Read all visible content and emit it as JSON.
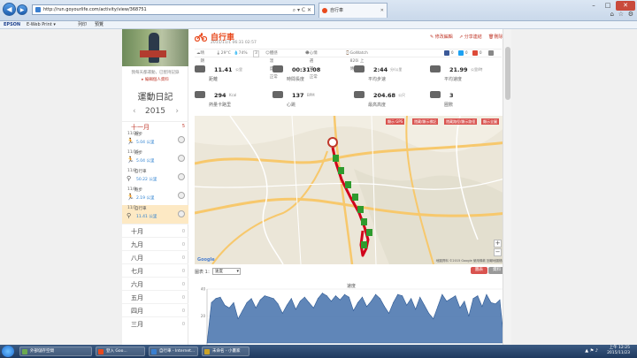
{
  "browser": {
    "address": "http://run.goyourlife.com/activity/view/368751",
    "tab_title": "自行車",
    "window_min": "–",
    "window_max": "□",
    "window_close": "✕",
    "nav_back": "◀",
    "nav_forward": "▶",
    "addr_controls": "⌕ ▾ C ✕",
    "tab_close": "✕",
    "tools_home": "⌂",
    "tools_star": "☆",
    "tools_gear": "⚙"
  },
  "favbar": {
    "epson": "EPSON",
    "eweb": "E-Web Print ▾",
    "print": "列印",
    "preview": "預覽"
  },
  "profile": {
    "text": "我每天都運動，已堅持記錄",
    "link": "▸ 編輯個人資料"
  },
  "diary": {
    "title": "運動日記",
    "year": "2015",
    "prev": "‹",
    "next": "›",
    "current_month": "十一月",
    "current_month_count": "5",
    "activities": [
      {
        "date": "11/22",
        "name": "跑步",
        "distance": "5.04 公里",
        "icon": "run-icon",
        "selected": false
      },
      {
        "date": "11/15",
        "name": "跑步",
        "distance": "5.04 公里",
        "icon": "run-icon",
        "selected": false
      },
      {
        "date": "11/8",
        "name": "自行車",
        "distance": "50.22 公里",
        "icon": "bike-icon",
        "selected": false
      },
      {
        "date": "11/8",
        "name": "跑步",
        "distance": "2.19 公里",
        "icon": "run-icon",
        "selected": false
      },
      {
        "date": "11/1",
        "name": "自行車",
        "distance": "11.41 公里",
        "icon": "bike-icon",
        "selected": true
      }
    ],
    "months": [
      {
        "name": "十月",
        "count": "0"
      },
      {
        "name": "九月",
        "count": "0"
      },
      {
        "name": "八月",
        "count": "0"
      },
      {
        "name": "七月",
        "count": "0"
      },
      {
        "name": "六月",
        "count": "0"
      },
      {
        "name": "五月",
        "count": "0"
      },
      {
        "name": "四月",
        "count": "0"
      },
      {
        "name": "三月",
        "count": "0"
      }
    ]
  },
  "activity": {
    "title": "自行車",
    "datetime": "2015/11/1 06:31 02:57",
    "buttons": {
      "edit": "修改編輯",
      "share": "分享連結",
      "delete": "刪除"
    },
    "meta": {
      "weather": "晴朗",
      "temp": "29°C",
      "humidity": "74%",
      "wind": "3",
      "feel": "體感溫度：正常",
      "mood": "心情選擇：正常",
      "device": "GoWatch 820i 上傳"
    },
    "share_counts": {
      "fb": "0",
      "twitter": "0",
      "google": "0"
    },
    "stats": [
      {
        "label": "距離",
        "value": "11.41",
        "unit": "公里"
      },
      {
        "label": "時間長度",
        "value": "00:31:08",
        "unit": ""
      },
      {
        "label": "平均步速",
        "value": "2:44",
        "unit": "分/公里"
      },
      {
        "label": "平均速度",
        "value": "21.99",
        "unit": "公里/時"
      },
      {
        "label": "熱量卡路里",
        "value": "294",
        "unit": "Kcal"
      },
      {
        "label": "心跳",
        "value": "137",
        "unit": "BPM"
      },
      {
        "label": "最高高度",
        "value": "204.68",
        "unit": "公尺"
      },
      {
        "label": "圈數",
        "value": "3",
        "unit": ""
      }
    ]
  },
  "map": {
    "buttons": [
      "顯示 GPS",
      "隱藏/顯示標記",
      "隱藏路徑/顯示路徑",
      "顯示全圖"
    ],
    "logo": "Google",
    "copyright": "地圖資料 ©2015 Google  使用條款  回報地圖錯誤",
    "zoom_in": "+",
    "zoom_out": "−"
  },
  "chart_controls": {
    "label": "圖表 1：",
    "selected": "速度",
    "btn_chart": "圖表",
    "btn_data": "資料"
  },
  "chart_data": {
    "type": "area",
    "title": "速度",
    "ylim": [
      0,
      40
    ],
    "yticks": [
      40,
      20
    ],
    "values": [
      0,
      30,
      33,
      34,
      28,
      26,
      30,
      18,
      24,
      30,
      33,
      26,
      32,
      35,
      34,
      33,
      29,
      22,
      28,
      33,
      25,
      31,
      34,
      30,
      26,
      33,
      37,
      35,
      31,
      35,
      32,
      36,
      34,
      24,
      30,
      34,
      27,
      31,
      36,
      33,
      27,
      22,
      30,
      36,
      35,
      28,
      33,
      25,
      34,
      28,
      22,
      18,
      27,
      36,
      31,
      33,
      35,
      26,
      31,
      20,
      33,
      35,
      27,
      36,
      30,
      29,
      32,
      0
    ]
  },
  "taskbar": {
    "items": [
      "外部儲存空間",
      "登入 Goo...",
      "自行車 - Internet...",
      "未命名 - 小畫家"
    ],
    "time": "上午 12:25",
    "date": "2015/11/23"
  }
}
